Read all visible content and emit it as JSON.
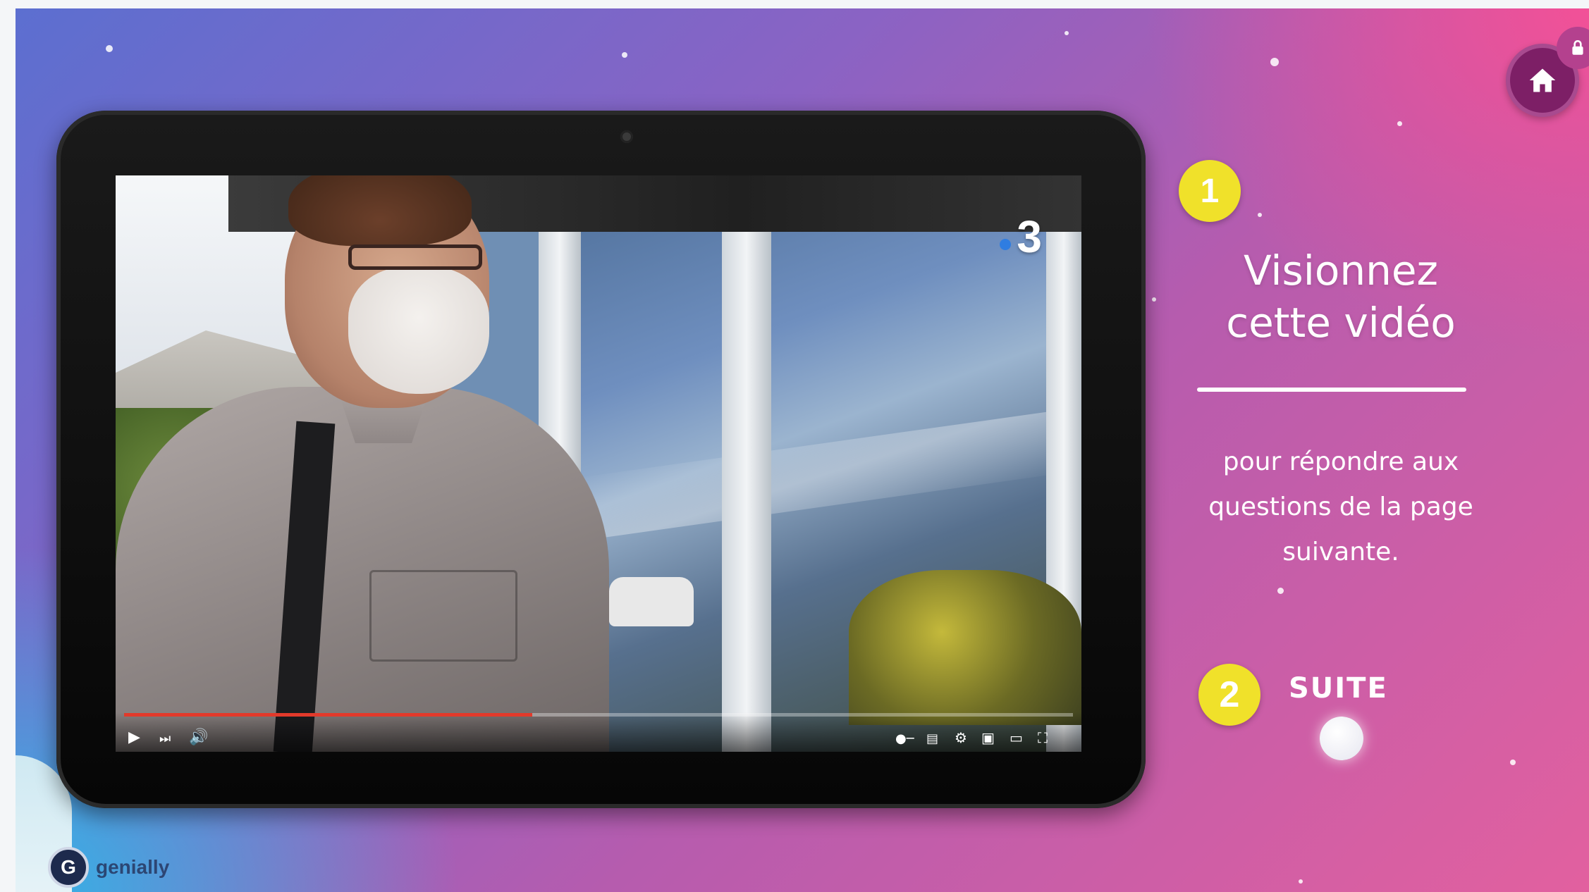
{
  "slide": {
    "step1_number": "1",
    "title_line1": "Visionnez",
    "title_line2": "cette vidéo",
    "subtitle_line1": "pour répondre aux",
    "subtitle_line2": "questions de la page",
    "subtitle_line3": "suivante.",
    "step2_number": "2",
    "next_label": "SUITE"
  },
  "video": {
    "channel_logo": "3",
    "progress": 0.43
  },
  "nav": {
    "home_icon": "home-icon",
    "lock_icon": "lock-icon"
  },
  "branding": {
    "logo_letter": "G",
    "name": "genially"
  },
  "colors": {
    "badge_yellow": "#f0e12a",
    "home_button": "#7d1f66",
    "progress_red": "#e23a2b"
  }
}
